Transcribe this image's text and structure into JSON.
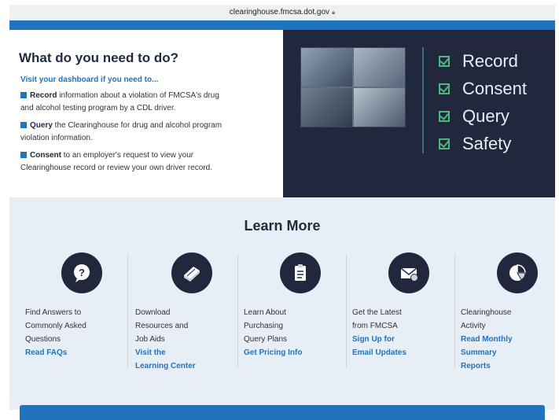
{
  "browser": {
    "url": "clearinghouse.fmcsa.dot.gov"
  },
  "intro": {
    "heading": "What do you need to do?",
    "dashboard_link": "Visit your dashboard if you need to...",
    "tasks": [
      {
        "keyword": "Record",
        "text": " information about a violation of FMCSA's drug",
        "line2": "and alcohol testing program by a CDL driver."
      },
      {
        "keyword": "Query",
        "text": " the Clearinghouse for drug and alcohol program",
        "line2": "violation information."
      },
      {
        "keyword": "Consent",
        "text": " to an employer's request to view your",
        "line2": "Clearinghouse record or review your own driver record."
      }
    ]
  },
  "hero": {
    "bullets": [
      "Record",
      "Consent",
      "Query",
      "Safety"
    ],
    "check_color": "#4db77f",
    "panel_color": "#21283d"
  },
  "learn_more": {
    "title": "Learn More",
    "columns": [
      {
        "icon": "question-chat-icon",
        "lines": [
          "Find Answers to",
          "Commonly Asked",
          "Questions"
        ],
        "actions": [
          "Read FAQs"
        ]
      },
      {
        "icon": "book-icon",
        "lines": [
          "Download",
          "Resources and",
          "Job Aids"
        ],
        "actions": [
          "Visit the",
          "Learning Center"
        ]
      },
      {
        "icon": "clipboard-icon",
        "lines": [
          "Learn About",
          "Purchasing",
          "Query Plans"
        ],
        "actions": [
          "Get Pricing Info"
        ]
      },
      {
        "icon": "email-icon",
        "lines": [
          "Get the Latest",
          "from FMCSA"
        ],
        "actions": [
          "Sign Up for",
          "Email Updates"
        ]
      },
      {
        "icon": "pie-chart-icon",
        "lines": [
          "Clearinghouse",
          "Activity"
        ],
        "actions": [
          "Read Monthly",
          "Summary",
          "Reports"
        ]
      }
    ]
  },
  "colors": {
    "accent_blue": "#1f74bd",
    "navy": "#21283d",
    "light_bg": "#e8eef5"
  }
}
